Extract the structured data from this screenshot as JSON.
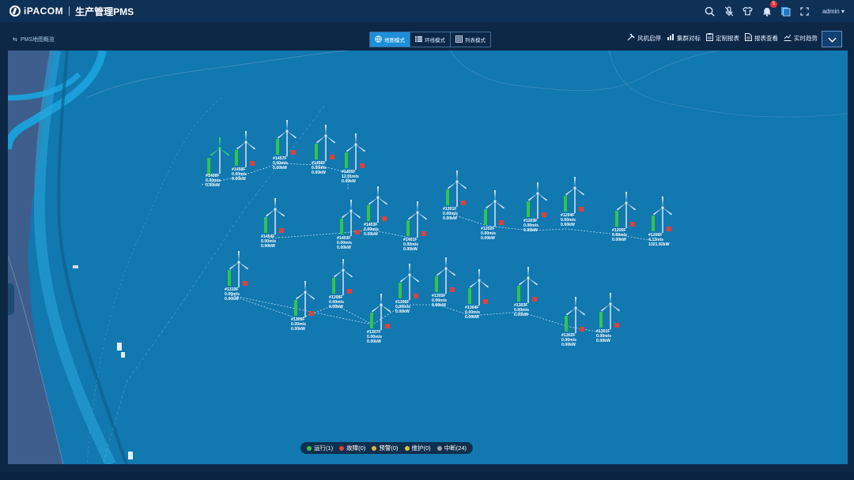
{
  "header": {
    "brand": "iPACOM",
    "app_name": "生产管理PMS",
    "notification_count": "5",
    "user": "admin"
  },
  "toolbar": {
    "breadcrumb": "PMS地图概览",
    "modes": [
      {
        "label": "地图模式",
        "icon": "globe-icon",
        "active": true
      },
      {
        "label": "环线模式",
        "icon": "list-icon",
        "active": false
      },
      {
        "label": "列表模式",
        "icon": "grid-icon",
        "active": false
      }
    ],
    "actions": [
      {
        "label": "风机启停",
        "icon": "tools-icon"
      },
      {
        "label": "集群对标",
        "icon": "bar-chart-icon"
      },
      {
        "label": "定制报表",
        "icon": "report-icon"
      },
      {
        "label": "报表查看",
        "icon": "document-icon"
      },
      {
        "label": "实时趋势",
        "icon": "trend-icon"
      }
    ]
  },
  "turbines": [
    {
      "id": "#1408F",
      "speed": "0.00m/s",
      "power": "0.00kW",
      "status": "running"
    },
    {
      "id": "#1458F",
      "speed": "0.00m/s",
      "power": "0.00kW",
      "status": "interrupted"
    },
    {
      "id": "#1457F",
      "speed": "0.00m/s",
      "power": "0.00kW",
      "status": "interrupted"
    },
    {
      "id": "#1456F",
      "speed": "0.00m/s",
      "power": "0.00kW",
      "status": "interrupted"
    },
    {
      "id": "#1455F",
      "speed": "12.01m/s",
      "power": "0.00kW",
      "status": "interrupted"
    },
    {
      "id": "#1454F",
      "speed": "0.00m/s",
      "power": "0.00kW",
      "status": "interrupted"
    },
    {
      "id": "#1403F",
      "speed": "0.00m/s",
      "power": "0.00kW",
      "status": "interrupted"
    },
    {
      "id": "#1453F",
      "speed": "0.00m/s",
      "power": "0.00kW",
      "status": "interrupted"
    },
    {
      "id": "#1401F",
      "speed": "0.00m/s",
      "power": "0.00kW",
      "status": "interrupted"
    },
    {
      "id": "#1301F",
      "speed": "0.00m/s",
      "power": "0.00kW",
      "status": "interrupted"
    },
    {
      "id": "#1202F",
      "speed": "0.00m/s",
      "power": "0.00kW",
      "status": "interrupted"
    },
    {
      "id": "#1203F",
      "speed": "0.00m/s",
      "power": "0.00kW",
      "status": "interrupted"
    },
    {
      "id": "#1204F",
      "speed": "0.00m/s",
      "power": "0.00kW",
      "status": "interrupted"
    },
    {
      "id": "#1205F",
      "speed": "0.00m/s",
      "power": "0.00kW",
      "status": "interrupted"
    },
    {
      "id": "#1206F",
      "speed": "4.13m/s",
      "power": "1321.92kW",
      "status": "interrupted"
    },
    {
      "id": "#1310F",
      "speed": "0.00m/s",
      "power": "0.00kW",
      "status": "interrupted"
    },
    {
      "id": "#1309F",
      "speed": "0.00m/s",
      "power": "0.00kW",
      "status": "interrupted"
    },
    {
      "id": "#1308F",
      "speed": "0.00m/s",
      "power": "0.00kW",
      "status": "interrupted"
    },
    {
      "id": "#1307F",
      "speed": "0.00m/s",
      "power": "0.00kW",
      "status": "interrupted"
    },
    {
      "id": "#1306F",
      "speed": "0.00m/s",
      "power": "0.00kW",
      "status": "interrupted"
    },
    {
      "id": "#1305F",
      "speed": "0.00m/s",
      "power": "0.00kW",
      "status": "interrupted"
    },
    {
      "id": "#1304F",
      "speed": "0.00m/s",
      "power": "0.00kW",
      "status": "interrupted"
    },
    {
      "id": "#1303F",
      "speed": "0.00m/s",
      "power": "0.00kW",
      "status": "interrupted"
    },
    {
      "id": "#1302F",
      "speed": "0.00m/s",
      "power": "0.00kW",
      "status": "interrupted"
    },
    {
      "id": "#1301F",
      "speed": "0.00m/s",
      "power": "0.00kW",
      "status": "interrupted"
    }
  ],
  "legend": [
    {
      "label": "运行(1)",
      "color": "#3fbf4f"
    },
    {
      "label": "故障(0)",
      "color": "#e0403a"
    },
    {
      "label": "预警(0)",
      "color": "#e6b23a"
    },
    {
      "label": "维护(0)",
      "color": "#d8c23a"
    },
    {
      "label": "中断(24)",
      "color": "#9aa5b1"
    }
  ]
}
